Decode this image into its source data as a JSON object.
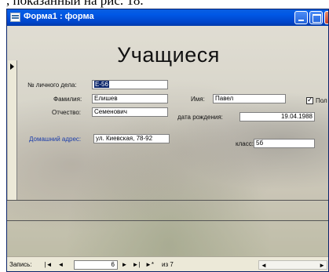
{
  "caption_text": ", показанный на рис. 18.",
  "window": {
    "title": "Форма1 : форма"
  },
  "form": {
    "heading": "Учащиеся",
    "fields": {
      "record_no": {
        "label": "№ личного дела:",
        "value": "Е-56"
      },
      "last_name": {
        "label": "Фамилия:",
        "value": "Елишев"
      },
      "first_name": {
        "label": "Имя:",
        "value": "Павел"
      },
      "patronymic": {
        "label": "Отчество:",
        "value": "Семенович"
      },
      "birth_date": {
        "label": "дата рождения:",
        "value": "19.04.1988"
      },
      "home_address": {
        "label": "Домашний адрес:",
        "value": "ул. Киевская, 78-92"
      },
      "class": {
        "label": "класс:",
        "value": "5б"
      }
    },
    "gender_checkbox": {
      "label": "Пол",
      "checked": true
    }
  },
  "record_nav": {
    "label": "Запись:",
    "first": "|◄",
    "prev": "◄",
    "current": "6",
    "next": "►",
    "last": "►|",
    "new": "►*",
    "total_text": "из 7"
  },
  "scroll": {
    "left": "◄",
    "right": "►"
  }
}
